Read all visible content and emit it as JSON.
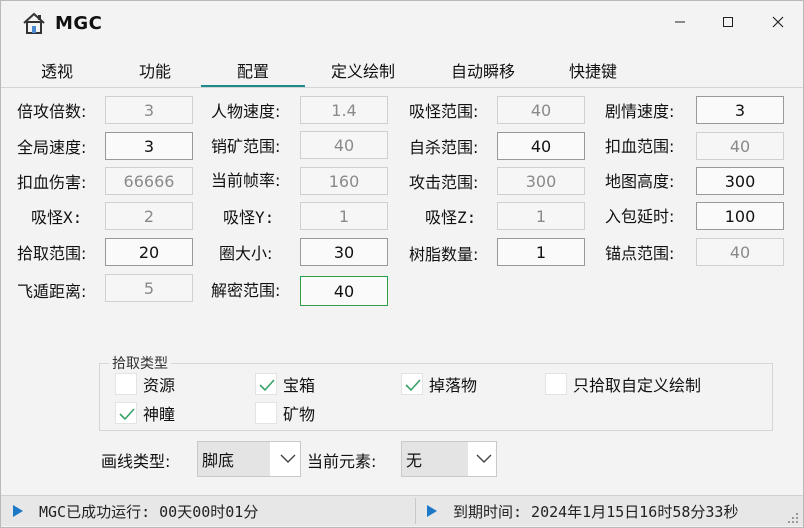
{
  "app": {
    "title": "MGC",
    "accent": "#1a8a8a",
    "focus_color": "#2e9e4a",
    "check_color": "#3aa36a"
  },
  "window_buttons": [
    "minimize-icon",
    "maximize-icon",
    "close-icon"
  ],
  "tabs": [
    {
      "label": "透视"
    },
    {
      "label": "功能"
    },
    {
      "label": "配置",
      "active": true
    },
    {
      "label": "定义绘制"
    },
    {
      "label": "自动瞬移"
    },
    {
      "label": "快捷键"
    }
  ],
  "form": {
    "beigong_label": "倍攻倍数:",
    "beigong_value": "3",
    "quanju_label": "全局速度:",
    "quanju_value": "3",
    "koushang_label": "扣血伤害:",
    "koushang_value": "66666",
    "xiguai_x_label": "吸怪X:",
    "xiguai_x_value": "2",
    "shiqu_label": "拾取范围:",
    "shiqu_value": "20",
    "feidun_label": "飞遁距离:",
    "feidun_value": "5",
    "renwu_label": "人物速度:",
    "renwu_value": "1.4",
    "xiaokuang_label": "销矿范围:",
    "xiaokuang_value": "40",
    "zhenlv_label": "当前帧率:",
    "zhenlv_value": "160",
    "xiguai_y_label": "吸怪Y:",
    "xiguai_y_value": "1",
    "quan_label": "圈大小:",
    "quan_value": "30",
    "jiemi_label": "解密范围:",
    "jiemi_value": "40",
    "xiguai_fw_label": "吸怪范围:",
    "xiguai_fw_value": "40",
    "zisha_label": "自杀范围:",
    "zisha_value": "40",
    "gongji_label": "攻击范围:",
    "gongji_value": "300",
    "xiguai_z_label": "吸怪Z:",
    "xiguai_z_value": "1",
    "shuzhi_label": "树脂数量:",
    "shuzhi_value": "1",
    "juqing_label": "剧情速度:",
    "juqing_value": "3",
    "kouxue_fw_label": "扣血范围:",
    "kouxue_fw_value": "40",
    "ditu_label": "地图高度:",
    "ditu_value": "300",
    "rubao_label": "入包延时:",
    "rubao_value": "100",
    "maodian_label": "锚点范围:",
    "maodian_value": "40"
  },
  "pickup": {
    "title": "拾取类型",
    "items": [
      {
        "label": "资源",
        "checked": false
      },
      {
        "label": "宝箱",
        "checked": true
      },
      {
        "label": "掉落物",
        "checked": true
      },
      {
        "label": "只拾取自定义绘制",
        "checked": false
      },
      {
        "label": "神瞳",
        "checked": true
      },
      {
        "label": "矿物",
        "checked": false
      }
    ]
  },
  "draw": {
    "line_type_label": "画线类型:",
    "line_type_value": "脚底",
    "element_label": "当前元素:",
    "element_value": "无"
  },
  "status": {
    "left": "MGC已成功运行: 00天00时01分",
    "right": "到期时间: 2024年1月15日16时58分33秒",
    "icon_color": "#1e78c8"
  }
}
